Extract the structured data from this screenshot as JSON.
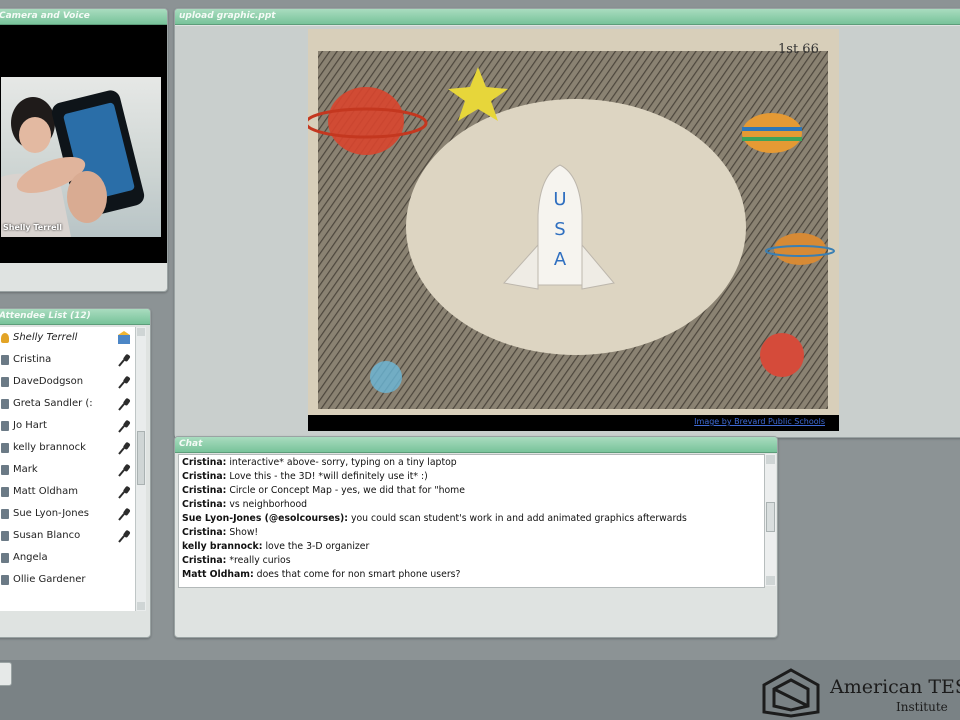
{
  "camera_pod": {
    "title": "Camera and Voice",
    "speaker_name": "Shelly Terrell"
  },
  "share_pod": {
    "title": "upload graphic.ppt",
    "credit": "Image by Brevard Public Schools"
  },
  "attendee_pod": {
    "title": "Attendee List (12)",
    "attendees": [
      {
        "name": "Shelly Terrell",
        "role": "host"
      },
      {
        "name": "Cristina"
      },
      {
        "name": "DaveDodgson"
      },
      {
        "name": "Greta Sandler (:"
      },
      {
        "name": "Jo Hart"
      },
      {
        "name": "kelly brannock"
      },
      {
        "name": "Mark"
      },
      {
        "name": "Matt Oldham"
      },
      {
        "name": "Sue Lyon-Jones"
      },
      {
        "name": "Susan Blanco"
      },
      {
        "name": "Angela"
      },
      {
        "name": "Ollie Gardener"
      }
    ]
  },
  "chat_pod": {
    "title": "Chat",
    "messages": [
      {
        "sender": "Cristina:",
        "text": "interactive* above- sorry, typing on a tiny laptop"
      },
      {
        "sender": "Cristina:",
        "text": "Love this - the 3D! *will definitely use it* :)"
      },
      {
        "sender": "Cristina:",
        "text": "Circle or Concept Map - yes, we did that for \"home"
      },
      {
        "sender": "Cristina:",
        "text": "vs neighborhood"
      },
      {
        "sender": "Sue Lyon-Jones (@esolcourses):",
        "text": "you could scan student's work in and add animated graphics afterwards"
      },
      {
        "sender": "Cristina:",
        "text": "Show!"
      },
      {
        "sender": "kelly brannock:",
        "text": "love the 3-D organizer"
      },
      {
        "sender": "Cristina:",
        "text": "*really curios"
      },
      {
        "sender": "Matt Oldham:",
        "text": "does that come for non smart phone users?"
      }
    ]
  },
  "branding": {
    "org_name": "American TESO",
    "org_sub": "Institute"
  },
  "drawing_words": {
    "rocket": "USA",
    "corner": "1st 66"
  },
  "colors": {
    "pod_header": "#78c39a",
    "link": "#3f6bd6",
    "page_bg": "#8c9395"
  }
}
